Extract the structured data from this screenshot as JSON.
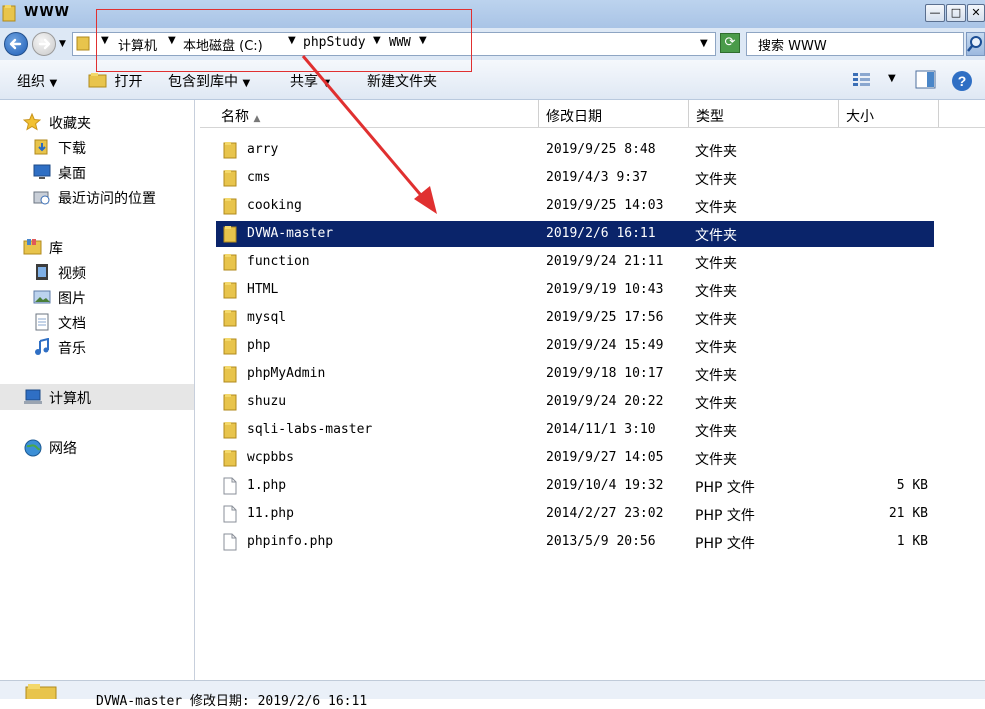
{
  "window": {
    "title": "WWW"
  },
  "address": {
    "crumbs": [
      "计算机",
      "本地磁盘 (C:)",
      "phpStudy",
      "WWW"
    ],
    "search_placeholder": "搜索 WWW"
  },
  "toolbar": {
    "organize": "组织",
    "open": "打开",
    "include_in_library": "包含到库中",
    "share": "共享",
    "new_folder": "新建文件夹"
  },
  "nav": {
    "favorites": "收藏夹",
    "downloads": "下载",
    "desktop": "桌面",
    "recent": "最近访问的位置",
    "libraries": "库",
    "videos": "视频",
    "pictures": "图片",
    "documents": "文档",
    "music": "音乐",
    "computer": "计算机",
    "network": "网络"
  },
  "columns": {
    "name": "名称",
    "modified": "修改日期",
    "type": "类型",
    "size": "大小"
  },
  "files": [
    {
      "name": "arry",
      "modified": "2019/9/25 8:48",
      "type": "文件夹",
      "size": "",
      "icon": "folder-icon"
    },
    {
      "name": "cms",
      "modified": "2019/4/3 9:37",
      "type": "文件夹",
      "size": "",
      "icon": "folder-icon"
    },
    {
      "name": "cooking",
      "modified": "2019/9/25 14:03",
      "type": "文件夹",
      "size": "",
      "icon": "folder-icon"
    },
    {
      "name": "DVWA-master",
      "modified": "2019/2/6 16:11",
      "type": "文件夹",
      "size": "",
      "icon": "folder-icon",
      "selected": true
    },
    {
      "name": "function",
      "modified": "2019/9/24 21:11",
      "type": "文件夹",
      "size": "",
      "icon": "folder-icon"
    },
    {
      "name": "HTML",
      "modified": "2019/9/19 10:43",
      "type": "文件夹",
      "size": "",
      "icon": "folder-icon"
    },
    {
      "name": "mysql",
      "modified": "2019/9/25 17:56",
      "type": "文件夹",
      "size": "",
      "icon": "folder-icon"
    },
    {
      "name": "php",
      "modified": "2019/9/24 15:49",
      "type": "文件夹",
      "size": "",
      "icon": "folder-icon"
    },
    {
      "name": "phpMyAdmin",
      "modified": "2019/9/18 10:17",
      "type": "文件夹",
      "size": "",
      "icon": "folder-icon"
    },
    {
      "name": "shuzu",
      "modified": "2019/9/24 20:22",
      "type": "文件夹",
      "size": "",
      "icon": "folder-icon"
    },
    {
      "name": "sqli-labs-master",
      "modified": "2014/11/1 3:10",
      "type": "文件夹",
      "size": "",
      "icon": "folder-icon"
    },
    {
      "name": "wcpbbs",
      "modified": "2019/9/27 14:05",
      "type": "文件夹",
      "size": "",
      "icon": "folder-icon"
    },
    {
      "name": "1.php",
      "modified": "2019/10/4 19:32",
      "type": "PHP 文件",
      "size": "5 KB",
      "icon": "file-icon"
    },
    {
      "name": "11.php",
      "modified": "2014/2/27 23:02",
      "type": "PHP 文件",
      "size": "21 KB",
      "icon": "file-icon"
    },
    {
      "name": "phpinfo.php",
      "modified": "2013/5/9 20:56",
      "type": "PHP 文件",
      "size": "1 KB",
      "icon": "file-icon"
    }
  ],
  "status": {
    "text": "DVWA-master 修改日期: 2019/2/6 16:11"
  },
  "colors": {
    "selection": "#0a246a",
    "annotation": "#e03030",
    "titlebar": "#a9c4e6"
  }
}
